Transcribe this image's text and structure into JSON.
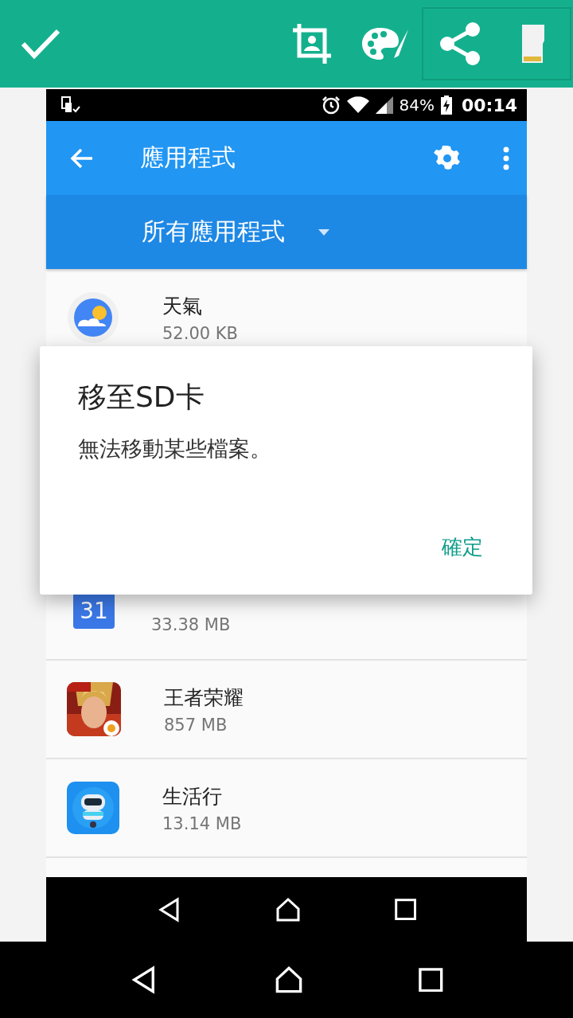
{
  "editor_toolbar": {
    "actions": [
      {
        "kind": "crop"
      },
      {
        "kind": "palette"
      },
      {
        "kind": "share"
      },
      {
        "kind": "sdcard"
      }
    ]
  },
  "status_bar": {
    "battery": "84%",
    "time": "00:14"
  },
  "app_bar": {
    "title": "應用程式"
  },
  "filter": {
    "label": "所有應用程式"
  },
  "apps": [
    {
      "kind": "weather",
      "name": "天氣",
      "size": "52.00 KB"
    },
    {
      "kind": "spacer"
    },
    {
      "kind": "calendar",
      "size": "33.38 MB",
      "icon_label": "31"
    },
    {
      "kind": "game",
      "name": "王者荣耀",
      "size": "857 MB"
    },
    {
      "kind": "robot",
      "name": "生活行",
      "size": "13.14 MB"
    }
  ],
  "dialog": {
    "title": "移至SD卡",
    "message": "無法移動某些檔案。",
    "button": "確定"
  }
}
